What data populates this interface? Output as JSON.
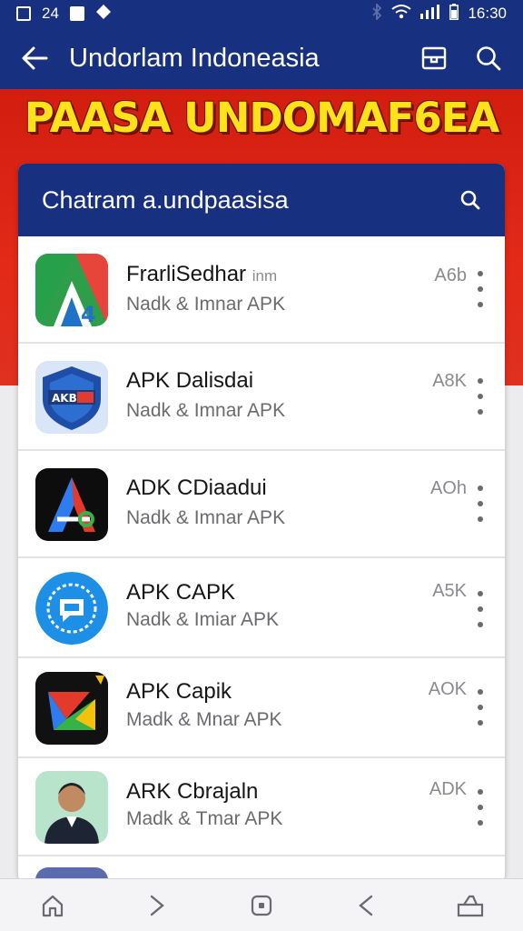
{
  "status_bar": {
    "left_text": "24",
    "time": "16:30"
  },
  "app_bar": {
    "title": "Undorlam Indoneasia"
  },
  "banner": {
    "title": "PAASA UNDOMAF6EA"
  },
  "search": {
    "placeholder": "Chatram a.undpaasisa"
  },
  "apps": [
    {
      "name": "FrarliSedhar",
      "extra": "inm",
      "subtitle": "Nadk & Imnar APK",
      "badge": "A6b"
    },
    {
      "name": "APK Dalisdai",
      "extra": "",
      "subtitle": "Nadk & Imnar APK",
      "badge": "A8K"
    },
    {
      "name": "ADK CDiaadui",
      "extra": "",
      "subtitle": "Nadk & Imnar APK",
      "badge": "AOh"
    },
    {
      "name": "APK CAPK",
      "extra": "",
      "subtitle": "Nadk & Imiar APK",
      "badge": "A5K"
    },
    {
      "name": "APK Capik",
      "extra": "",
      "subtitle": "Madk & Mnar APK",
      "badge": "AOK"
    },
    {
      "name": "ARK Cbrajaln",
      "extra": "",
      "subtitle": "Madk & Tmar APK",
      "badge": "ADK"
    }
  ],
  "icon_names": {
    "back": "arrow-left-icon",
    "save": "bookmark-icon",
    "search": "search-icon",
    "nav": [
      "home-icon",
      "forward-icon",
      "recents-icon",
      "back-icon",
      "bag-icon"
    ]
  },
  "colors": {
    "primary": "#17307f",
    "banner_red": "#d21d10",
    "banner_text": "#ffe21a"
  }
}
